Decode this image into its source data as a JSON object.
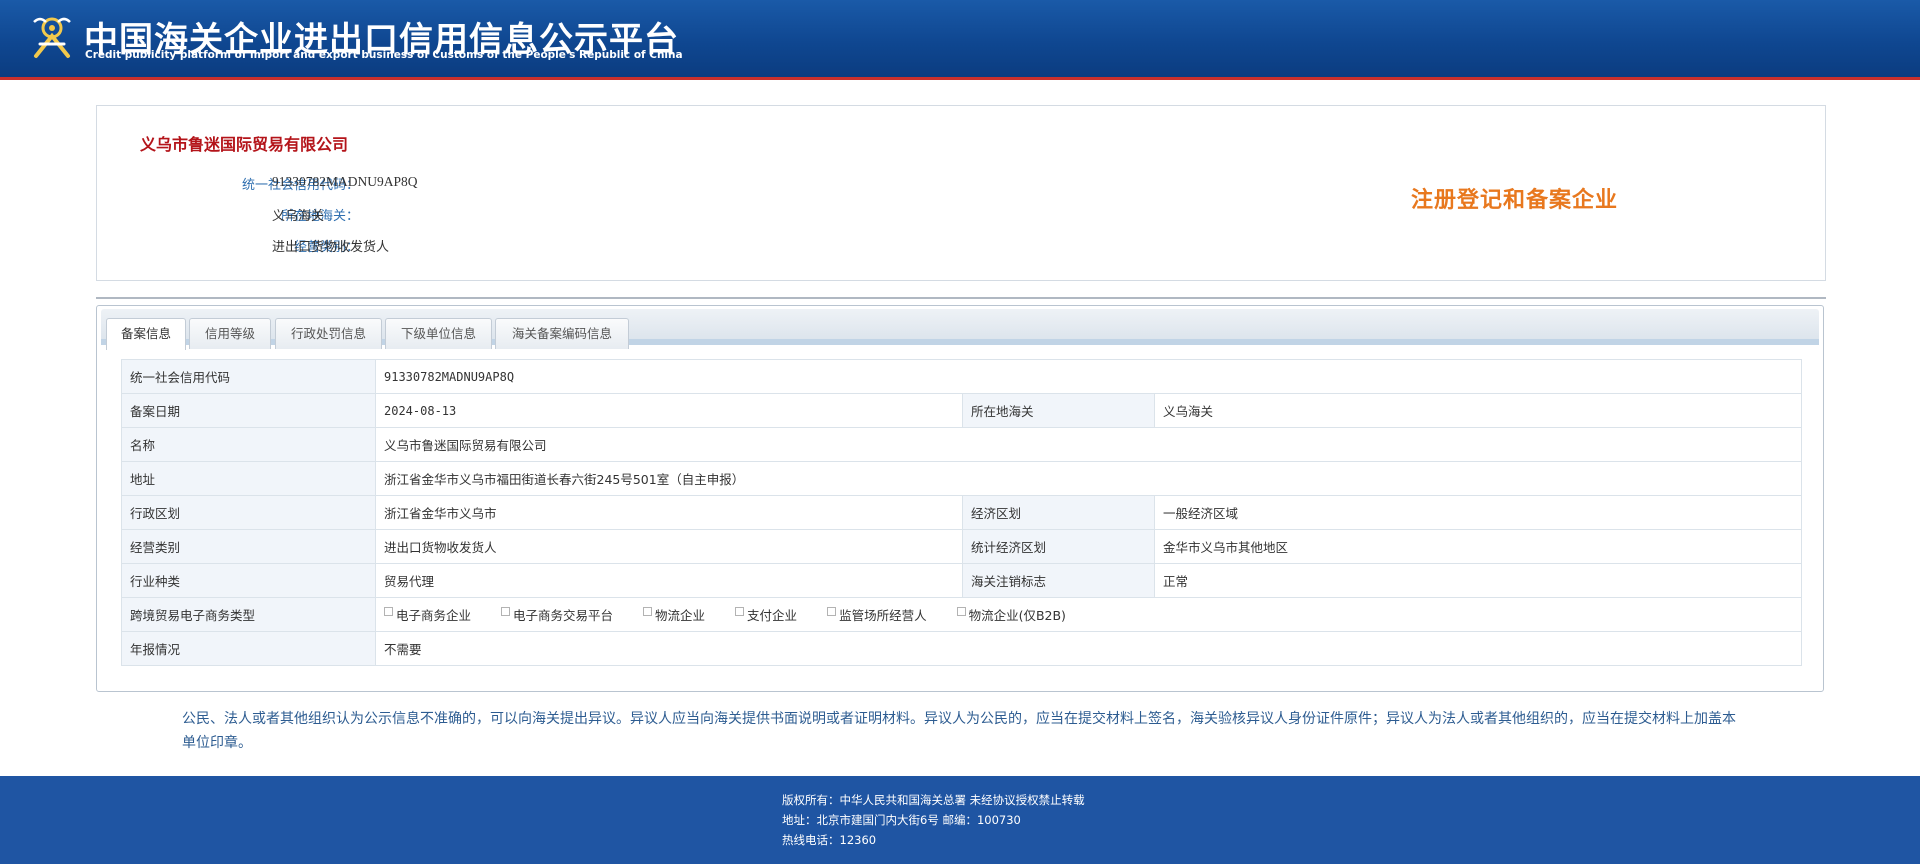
{
  "header": {
    "title_cn": "中国海关企业进出口信用信息公示平台",
    "title_en": "Credit publicity platform of import and export business of Customs of the People's Republic of China",
    "logo_icon": "customs-emblem-icon",
    "colors": {
      "bar": "#0f4791",
      "accent_line": "#c9302c"
    }
  },
  "company": {
    "name": "义乌市鲁迷国际贸易有限公司",
    "fields": [
      {
        "label": "统一社会信用代码：",
        "value": "91330782MADNU9AP8Q"
      },
      {
        "label": "所在地海关：",
        "value": "义乌海关"
      },
      {
        "label": "经营类别：",
        "value": "进出口货物收发货人"
      }
    ],
    "stamp": "注册登记和备案企业",
    "colors": {
      "name": "#b4141a",
      "label": "#2f6fb0",
      "stamp": "#e8781e"
    }
  },
  "tabs": [
    {
      "label": "备案信息",
      "active": true
    },
    {
      "label": "信用等级",
      "active": false
    },
    {
      "label": "行政处罚信息",
      "active": false
    },
    {
      "label": "下级单位信息",
      "active": false
    },
    {
      "label": "海关备案编码信息",
      "active": false
    }
  ],
  "record": {
    "credit_code_label": "统一社会信用代码",
    "credit_code": "91330782MADNU9AP8Q",
    "date_label": "备案日期",
    "date": "2024-08-13",
    "customs_label": "所在地海关",
    "customs": "义乌海关",
    "name_label": "名称",
    "name": "义乌市鲁迷国际贸易有限公司",
    "address_label": "地址",
    "address": "浙江省金华市义乌市福田街道长春六街245号501室（自主申报）",
    "admin_region_label": "行政区划",
    "admin_region": "浙江省金华市义乌市",
    "econ_zone_label": "经济区划",
    "econ_zone": "一般经济区域",
    "biz_type_label": "经营类别",
    "biz_type": "进出口货物收发货人",
    "stat_zone_label": "统计经济区划",
    "stat_zone": "金华市义乌市其他地区",
    "industry_label": "行业种类",
    "industry": "贸易代理",
    "cancel_flag_label": "海关注销标志",
    "cancel_flag": "正常",
    "ecommerce_label": "跨境贸易电子商务类型",
    "ecommerce_options": [
      {
        "label": "电子商务企业",
        "checked": false
      },
      {
        "label": "电子商务交易平台",
        "checked": false
      },
      {
        "label": "物流企业",
        "checked": false
      },
      {
        "label": "支付企业",
        "checked": false
      },
      {
        "label": "监管场所经营人",
        "checked": false
      },
      {
        "label": "物流企业(仅B2B)",
        "checked": false
      }
    ],
    "annual_report_label": "年报情况",
    "annual_report": "不需要"
  },
  "notice": "公民、法人或者其他组织认为公示信息不准确的，可以向海关提出异议。异议人应当向海关提供书面说明或者证明材料。异议人为公民的，应当在提交材料上签名，海关验核异议人身份证件原件；异议人为法人或者其他组织的，应当在提交材料上加盖本单位印章。",
  "footer": {
    "copyright": "版权所有：中华人民共和国海关总署   未经协议授权禁止转载",
    "address": "地址：北京市建国门内大街6号 邮编：100730",
    "hotline": "热线电话：12360",
    "colors": {
      "background": "#1f55a3"
    }
  }
}
